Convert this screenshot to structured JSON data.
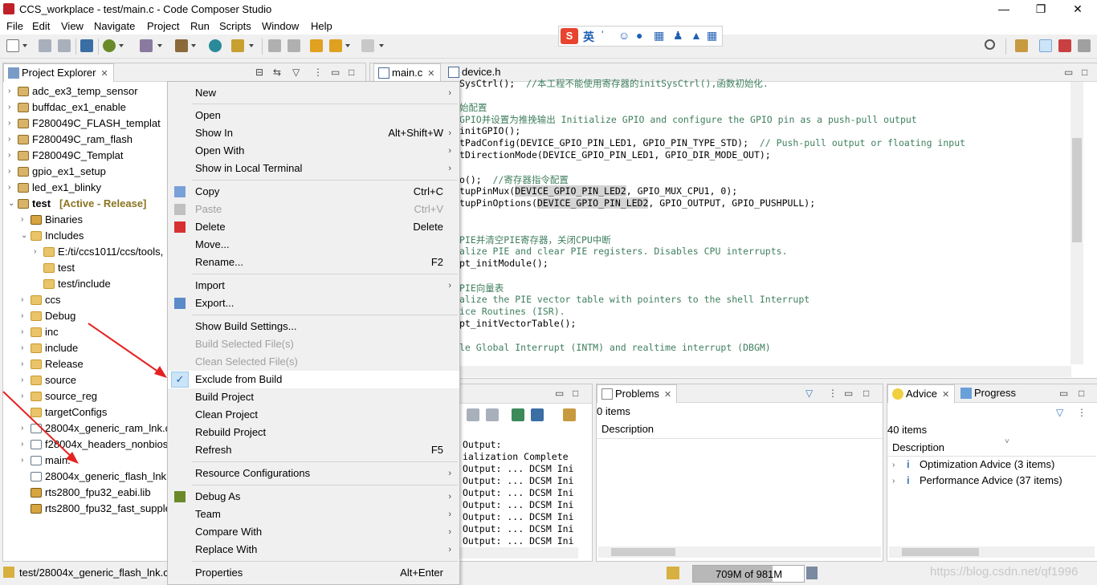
{
  "window": {
    "title": "CCS_workplace - test/main.c - Code Composer Studio",
    "min": "—",
    "max": "❐",
    "close": "✕"
  },
  "menubar": [
    "File",
    "Edit",
    "View",
    "Navigate",
    "Project",
    "Run",
    "Scripts",
    "Window",
    "Help"
  ],
  "ime": {
    "logo": "S",
    "mode": "英"
  },
  "project_explorer": {
    "title": "Project Explorer",
    "items": [
      {
        "label": "adc_ex3_temp_sensor"
      },
      {
        "label": "buffdac_ex1_enable"
      },
      {
        "label": "F280049C_FLASH_templat"
      },
      {
        "label": "F280049C_ram_flash"
      },
      {
        "label": "F280049C_Templat"
      },
      {
        "label": "gpio_ex1_setup"
      },
      {
        "label": "led_ex1_blinky"
      },
      {
        "label": "test",
        "tag": "[Active - Release]"
      },
      {
        "label": "Binaries"
      },
      {
        "label": "Includes"
      },
      {
        "label": "E:/ti/ccs1011/ccs/tools,"
      },
      {
        "label": "test"
      },
      {
        "label": "test/include"
      },
      {
        "label": "ccs"
      },
      {
        "label": "Debug"
      },
      {
        "label": "inc"
      },
      {
        "label": "include"
      },
      {
        "label": "Release"
      },
      {
        "label": "source"
      },
      {
        "label": "source_reg"
      },
      {
        "label": "targetConfigs"
      },
      {
        "label": "28004x_generic_ram_lnk.c"
      },
      {
        "label": "f28004x_headers_nonbios"
      },
      {
        "label": "main."
      },
      {
        "label": "28004x_generic_flash_lnk.c"
      },
      {
        "label": "rts2800_fpu32_eabi.lib"
      },
      {
        "label": "rts2800_fpu32_fast_supple"
      }
    ]
  },
  "context_menu": {
    "items": [
      {
        "label": "New",
        "submenu": true
      },
      {
        "label": "Open"
      },
      {
        "label": "Show In",
        "shortcut": "Alt+Shift+W",
        "submenu": true
      },
      {
        "label": "Open With",
        "submenu": true
      },
      {
        "label": "Show in Local Terminal",
        "submenu": true
      },
      {
        "label": "Copy",
        "shortcut": "Ctrl+C"
      },
      {
        "label": "Paste",
        "shortcut": "Ctrl+V",
        "disabled": true
      },
      {
        "label": "Delete",
        "shortcut": "Delete"
      },
      {
        "label": "Move..."
      },
      {
        "label": "Rename...",
        "shortcut": "F2"
      },
      {
        "label": "Import",
        "submenu": true
      },
      {
        "label": "Export..."
      },
      {
        "label": "Show Build Settings..."
      },
      {
        "label": "Build Selected File(s)",
        "disabled": true
      },
      {
        "label": "Clean Selected File(s)",
        "disabled": true
      },
      {
        "label": "Exclude from Build",
        "checked": true
      },
      {
        "label": "Build Project"
      },
      {
        "label": "Clean Project"
      },
      {
        "label": "Rebuild Project"
      },
      {
        "label": "Refresh",
        "shortcut": "F5"
      },
      {
        "label": "Resource Configurations",
        "submenu": true
      },
      {
        "label": "Debug As",
        "submenu": true
      },
      {
        "label": "Team",
        "submenu": true
      },
      {
        "label": "Compare With",
        "submenu": true
      },
      {
        "label": "Replace With",
        "submenu": true
      },
      {
        "label": "Properties",
        "shortcut": "Alt+Enter"
      }
    ]
  },
  "editor": {
    "tabs": [
      {
        "label": "main.c"
      },
      {
        "label": "device.h"
      }
    ],
    "lines": [
      {
        "code": "SysCtrl();",
        "comment": "  //本工程不能使用寄存器的initSysCtrl(),函数初始化."
      },
      {
        "code": "",
        "comment": ""
      },
      {
        "code": "",
        "comment": "始配置"
      },
      {
        "code": "",
        "comment": "GPIO并设置为推挽输出 Initialize GPIO and configure the GPIO pin as a push-pull output"
      },
      {
        "code": "initGPIO();",
        "comment": ""
      },
      {
        "code": "tPadConfig(DEVICE_GPIO_PIN_LED1, GPIO_PIN_TYPE_STD);",
        "comment": "  // Push-pull output or floating input"
      },
      {
        "code": "tDirectionMode(DEVICE_GPIO_PIN_LED1, GPIO_DIR_MODE_OUT);",
        "comment": ""
      },
      {
        "code": "",
        "comment": ""
      },
      {
        "code": "o();",
        "comment": "  //寄存器指令配置"
      },
      {
        "code": "tupPinMux(",
        "hl": "DEVICE_GPIO_PIN_LED2",
        "rest": ", GPIO_MUX_CPU1, 0);"
      },
      {
        "code": "tupPinOptions(",
        "hl": "DEVICE_GPIO_PIN_LED2",
        "rest": ", GPIO_OUTPUT, GPIO_PUSHPULL);"
      },
      {
        "code": "",
        "comment": ""
      },
      {
        "code": "",
        "comment": ""
      },
      {
        "code": "",
        "comment": "PIE并清空PIE寄存器，关闭CPU中断"
      },
      {
        "code": "",
        "comment": "alize PIE and clear PIE registers. Disables CPU interrupts."
      },
      {
        "code": "pt_initModule();",
        "comment": ""
      },
      {
        "code": "",
        "comment": ""
      },
      {
        "code": "",
        "comment": "PIE向量表"
      },
      {
        "code": "",
        "comment": "alize the PIE vector table with pointers to the shell Interrupt"
      },
      {
        "code": "",
        "comment": "ice Routines (ISR)."
      },
      {
        "code": "pt_initVectorTable();",
        "comment": ""
      },
      {
        "code": "",
        "comment": ""
      },
      {
        "code": "",
        "comment": "le Global Interrupt (INTM) and realtime interrupt (DBGM)"
      }
    ]
  },
  "console": {
    "lines": [
      "Output:",
      "ialization Complete",
      "Output: ... DCSM Ini",
      "Output: ... DCSM Ini",
      "Output: ... DCSM Ini",
      "Output: ... DCSM Ini",
      "Output: ... DCSM Ini",
      "Output: ... DCSM Ini",
      "Output: ... DCSM Ini"
    ]
  },
  "problems": {
    "title": "Problems",
    "count": "0 items",
    "col": "Description"
  },
  "advice": {
    "title": "Advice",
    "tab2": "Progress",
    "count": "40 items",
    "col": "Description",
    "items": [
      "Optimization Advice (3 items)",
      "Performance Advice (37 items)"
    ]
  },
  "status": {
    "path": "test/28004x_generic_flash_lnk.cm",
    "heap": "709M of 981M",
    "heap_fraction": 0.72,
    "watermark": "https://blog.csdn.net/qf1996"
  }
}
